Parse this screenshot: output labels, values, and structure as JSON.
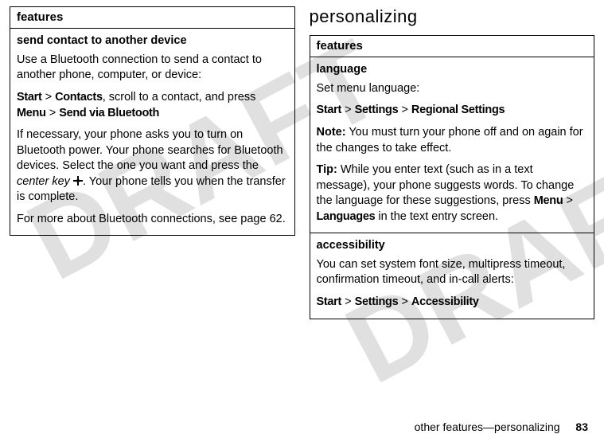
{
  "watermark": "DRAFT",
  "left": {
    "header": "features",
    "row1": {
      "title": "send contact to another device",
      "p1": "Use a Bluetooth connection to send a contact to another phone, computer, or device:",
      "path": {
        "a": "Start",
        "sep1": " > ",
        "b": "Contacts",
        "rest": ", scroll to a contact, and press ",
        "c": "Menu",
        "sep2": " > ",
        "d": "Send via Bluetooth"
      },
      "p2a": "If necessary, your phone asks you to turn on Bluetooth power. Your phone searches for Bluetooth devices. Select the one you want and press the ",
      "p2key": "center key",
      "p2b": ". Your phone tells you when the transfer is complete.",
      "p3": "For more about Bluetooth connections, see page 62."
    }
  },
  "right": {
    "section": "personalizing",
    "header": "features",
    "row1": {
      "title": "language",
      "p1": "Set menu language:",
      "path": {
        "a": "Start",
        "sep1": " > ",
        "b": "Settings",
        "sep2": " > ",
        "c": "Regional Settings"
      },
      "noteLabel": "Note:",
      "note": " You must turn your phone off and on again for the changes to take effect.",
      "tipLabel": "Tip:",
      "tipA": " While you enter text (such as in a text message), your phone suggests words. To change the language for these suggestions, press ",
      "tipMenu": "Menu",
      "tipSep": " > ",
      "tipLang": "Languages",
      "tipB": " in the text entry screen."
    },
    "row2": {
      "title": "accessibility",
      "p1": "You can set system font size, multipress timeout, confirmation timeout, and in-call alerts:",
      "path": {
        "a": "Start",
        "sep1": " > ",
        "b": "Settings",
        "sep2": " > ",
        "c": "Accessibility"
      }
    }
  },
  "footer": {
    "text": "other features—personalizing",
    "page": "83"
  }
}
